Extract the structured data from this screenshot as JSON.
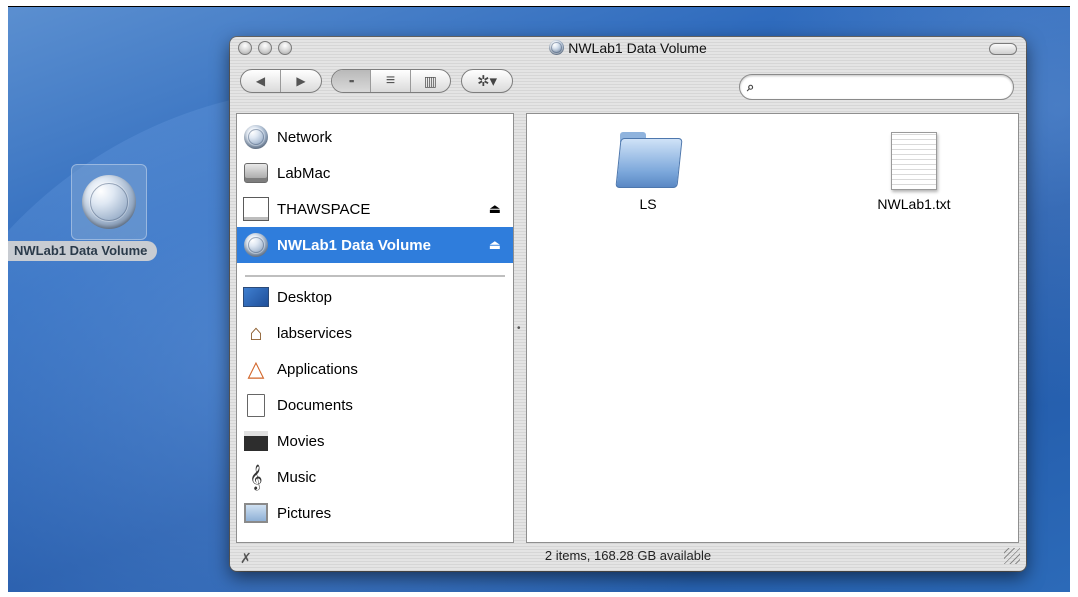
{
  "desktop": {
    "volume_label": "NWLab1 Data Volume"
  },
  "window": {
    "title": "NWLab1 Data Volume"
  },
  "toolbar": {
    "back_glyph": "◀",
    "forward_glyph": "▶",
    "view_icon_glyph": "▪▪",
    "view_list_glyph": "≡",
    "view_column_glyph": "▥",
    "action_glyph": "✲▾"
  },
  "search": {
    "placeholder": "",
    "value": ""
  },
  "sidebar": {
    "devices": [
      {
        "label": "Network",
        "icon": "network-globe-icon",
        "eject": false,
        "selected": false
      },
      {
        "label": "LabMac",
        "icon": "hard-drive-icon",
        "eject": false,
        "selected": false
      },
      {
        "label": "THAWSPACE",
        "icon": "white-drive-icon",
        "eject": true,
        "selected": false
      },
      {
        "label": "NWLab1 Data Volume",
        "icon": "network-volume-icon",
        "eject": true,
        "selected": true
      }
    ],
    "places": [
      {
        "label": "Desktop",
        "icon": "desktop-icon"
      },
      {
        "label": "labservices",
        "icon": "home-icon"
      },
      {
        "label": "Applications",
        "icon": "applications-icon"
      },
      {
        "label": "Documents",
        "icon": "documents-icon"
      },
      {
        "label": "Movies",
        "icon": "movies-icon"
      },
      {
        "label": "Music",
        "icon": "music-icon"
      },
      {
        "label": "Pictures",
        "icon": "pictures-icon"
      }
    ],
    "eject_glyph": "⏏"
  },
  "content": {
    "files": [
      {
        "name": "LS",
        "kind": "folder",
        "icon": "folder-icon"
      },
      {
        "name": "NWLab1.txt",
        "kind": "text document",
        "icon": "text-document-icon"
      }
    ]
  },
  "status": {
    "text": "2 items, 168.28 GB available"
  }
}
